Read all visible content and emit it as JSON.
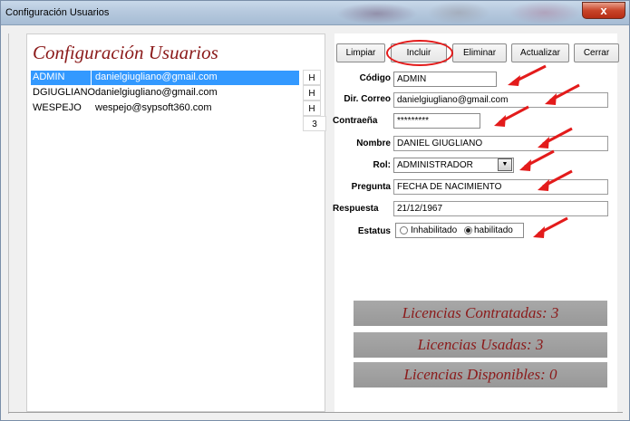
{
  "window": {
    "title": "Configuración Usuarios",
    "close_label": "x"
  },
  "form": {
    "heading": "Configuración Usuarios"
  },
  "users": [
    {
      "code": "ADMIN",
      "email": "danielgiugliano@gmail.com",
      "flag": "H",
      "selected": true
    },
    {
      "code": "DGIUGLIANO",
      "email": "danielgiugliano@gmail.com",
      "flag": "H",
      "selected": false
    },
    {
      "code": "WESPEJO",
      "email": "wespejo@sypsoft360.com",
      "flag": "H",
      "selected": false
    }
  ],
  "user_count": "3",
  "toolbar": {
    "limpiar": "Limpiar",
    "incluir": "Incluir",
    "eliminar": "Eliminar",
    "actualizar": "Actualizar",
    "cerrar": "Cerrar"
  },
  "fields": {
    "codigo": {
      "label": "Código",
      "value": "ADMIN"
    },
    "correo": {
      "label": "Dir. Correo",
      "value": "danielgiugliano@gmail.com"
    },
    "contrasena": {
      "label": "Contraeña",
      "value": "*********"
    },
    "nombre": {
      "label": "Nombre",
      "value": "DANIEL GIUGLIANO"
    },
    "rol": {
      "label": "Rol:",
      "value": "ADMINISTRADOR"
    },
    "pregunta": {
      "label": "Pregunta",
      "value": "FECHA DE NACIMIENTO"
    },
    "respuesta": {
      "label": "Respuesta",
      "value": "21/12/1967"
    },
    "estatus": {
      "label": "Estatus",
      "option_inhabilitado": "Inhabilitado",
      "option_habilitado": "habilitado",
      "selected": "habilitado"
    }
  },
  "licencias": {
    "contratadas": "Licencias Contratadas: 3",
    "usadas": "Licencias Usadas: 3",
    "disponibles": "Licencias Disponibles: 0"
  },
  "colors": {
    "selection": "#3399ff",
    "heading": "#8b1a1a",
    "annotation": "#e31b1b",
    "license_bar": "#a0a0a0"
  },
  "icons": {
    "combo": "chevron-down-icon",
    "annotation": "red-arrow-icon"
  }
}
